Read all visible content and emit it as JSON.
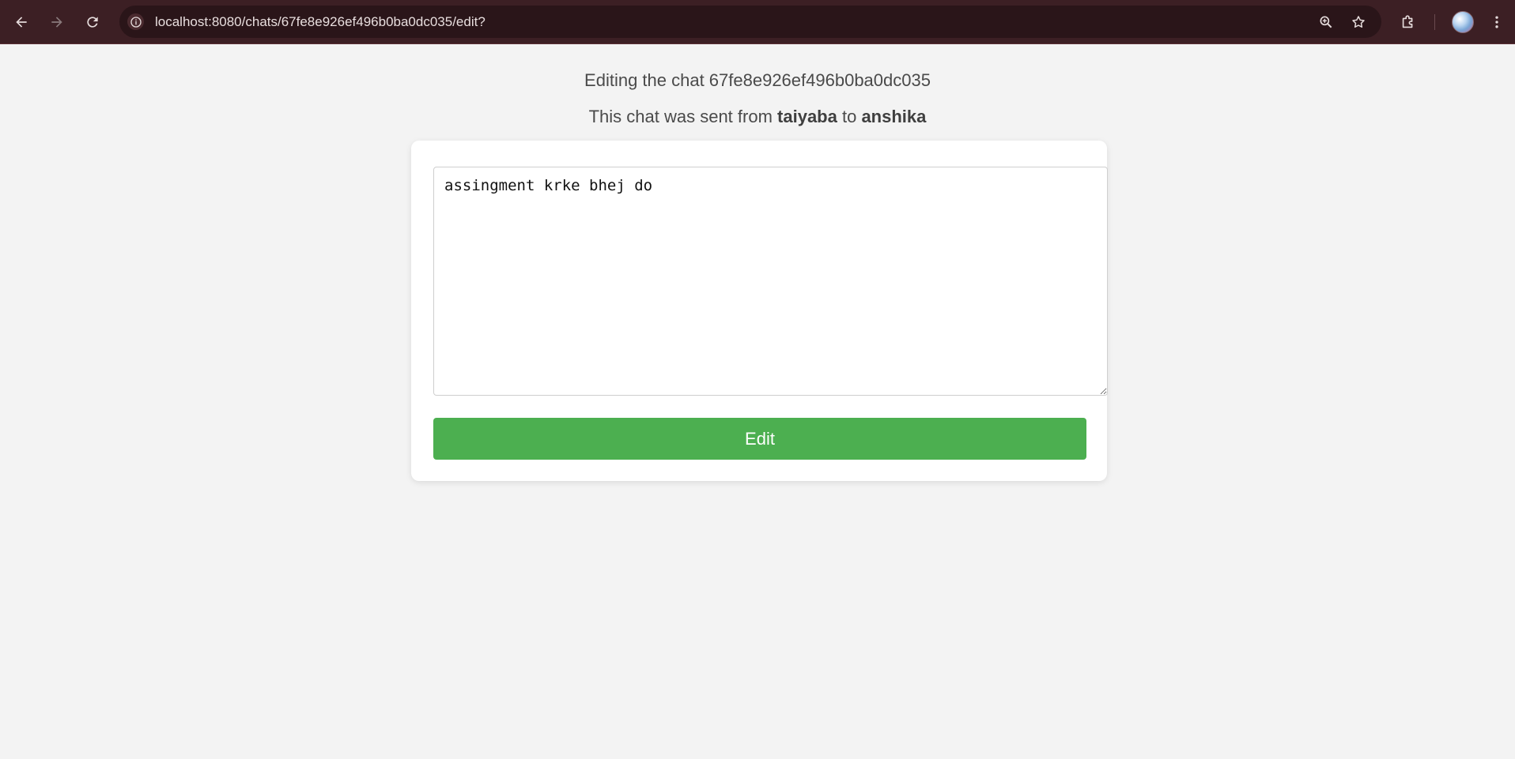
{
  "browser": {
    "url": "localhost:8080/chats/67fe8e926ef496b0ba0dc035/edit?"
  },
  "page": {
    "heading": "Editing the chat 67fe8e926ef496b0ba0dc035",
    "sent_prefix": "This chat was sent from ",
    "from": "taiyaba",
    "sent_middle": " to ",
    "to": "anshika"
  },
  "form": {
    "message": "assingment krke bhej do",
    "submit_label": "Edit"
  },
  "colors": {
    "browser_bar": "#3c1f24",
    "page_background": "#f3f3f3",
    "button": "#4caf50"
  }
}
